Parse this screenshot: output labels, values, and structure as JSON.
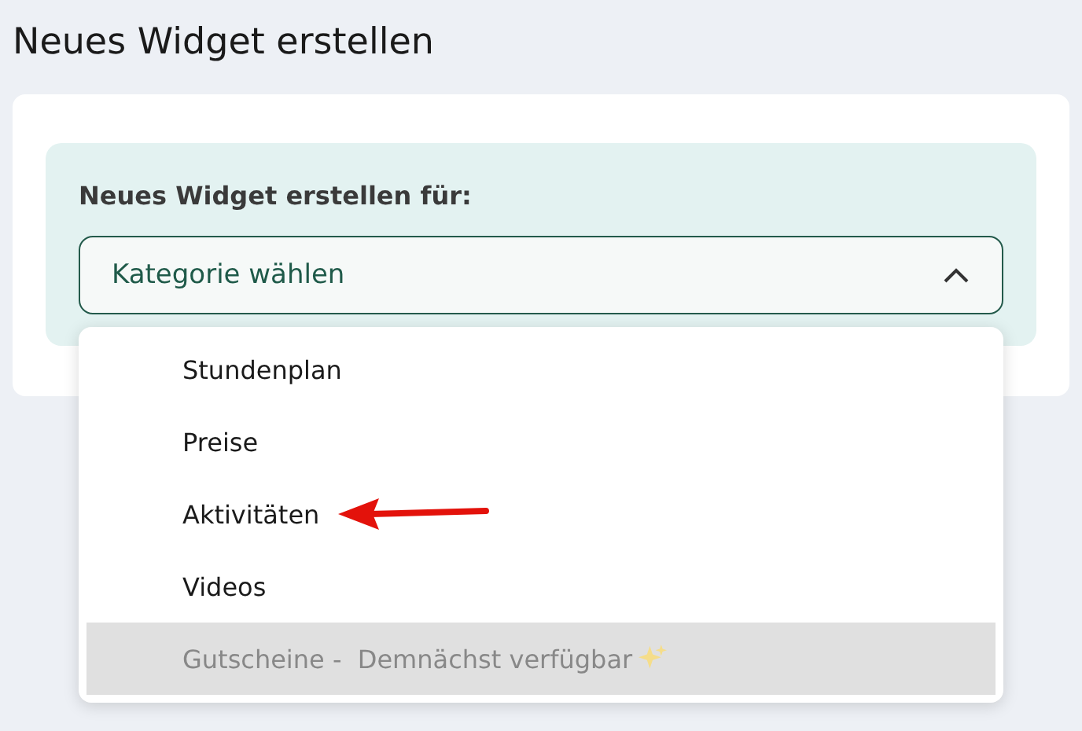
{
  "title": "Neues Widget erstellen",
  "form": {
    "label": "Neues Widget erstellen für:",
    "select": {
      "placeholder": "Kategorie wählen",
      "expanded": true
    }
  },
  "options": [
    {
      "label": "Stundenplan",
      "disabled": false,
      "marked": false
    },
    {
      "label": "Preise",
      "disabled": false,
      "marked": false
    },
    {
      "label": "Aktivitäten",
      "disabled": false,
      "marked": true
    },
    {
      "label": "Videos",
      "disabled": false,
      "marked": false
    },
    {
      "label": "Gutscheine -  Demnächst verfügbar",
      "disabled": true,
      "marked": false
    }
  ]
}
